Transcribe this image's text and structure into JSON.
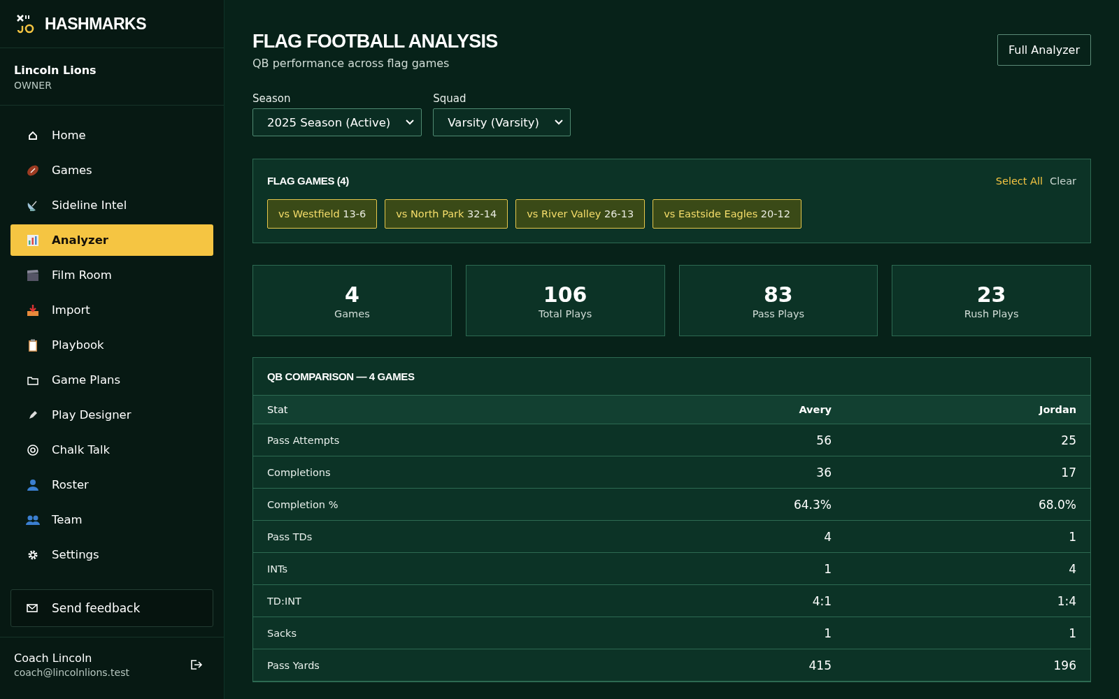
{
  "brand": "HASHMARKS",
  "team": {
    "name": "Lincoln Lions",
    "role": "OWNER"
  },
  "nav": [
    {
      "label": "Home",
      "selected": false
    },
    {
      "label": "Games",
      "selected": false
    },
    {
      "label": "Sideline Intel",
      "selected": false
    },
    {
      "label": "Analyzer",
      "selected": true
    },
    {
      "label": "Film Room",
      "selected": false
    },
    {
      "label": "Import",
      "selected": false
    },
    {
      "label": "Playbook",
      "selected": false
    },
    {
      "label": "Game Plans",
      "selected": false
    },
    {
      "label": "Play Designer",
      "selected": false
    },
    {
      "label": "Chalk Talk",
      "selected": false
    },
    {
      "label": "Roster",
      "selected": false
    },
    {
      "label": "Team",
      "selected": false
    },
    {
      "label": "Settings",
      "selected": false
    }
  ],
  "feedback_button": "Send feedback",
  "user": {
    "name": "Coach Lincoln",
    "email": "coach@lincolnlions.test"
  },
  "page": {
    "title": "FLAG FOOTBALL ANALYSIS",
    "subtitle": "QB performance across flag games",
    "action": "Full Analyzer"
  },
  "filters": [
    {
      "label": "Season",
      "value": "2025 Season (Active)"
    },
    {
      "label": "Squad",
      "value": "Varsity (Varsity)"
    }
  ],
  "games_panel": {
    "title": "FLAG GAMES (4)",
    "select_all": "Select All",
    "clear": "Clear",
    "games": [
      {
        "opponent": "vs Westfield",
        "score": "13-6",
        "selected": true
      },
      {
        "opponent": "vs North Park",
        "score": "32-14",
        "selected": true
      },
      {
        "opponent": "vs River Valley",
        "score": "26-13",
        "selected": true
      },
      {
        "opponent": "vs Eastside Eagles",
        "score": "20-12",
        "selected": true
      }
    ]
  },
  "summary": [
    {
      "value": "4",
      "label": "Games"
    },
    {
      "value": "106",
      "label": "Total Plays"
    },
    {
      "value": "83",
      "label": "Pass Plays"
    },
    {
      "value": "23",
      "label": "Rush Plays"
    }
  ],
  "comparison": {
    "title": "QB COMPARISON — 4 GAMES",
    "columns": [
      "Stat",
      "Avery",
      "Jordan"
    ],
    "rows": [
      [
        "Pass Attempts",
        "56",
        "25"
      ],
      [
        "Completions",
        "36",
        "17"
      ],
      [
        "Completion %",
        "64.3%",
        "68.0%"
      ],
      [
        "Pass TDs",
        "4",
        "1"
      ],
      [
        "INTs",
        "1",
        "4"
      ],
      [
        "TD:INT",
        "4:1",
        "1:4"
      ],
      [
        "Sacks",
        "1",
        "1"
      ],
      [
        "Pass Yards",
        "415",
        "196"
      ]
    ]
  }
}
